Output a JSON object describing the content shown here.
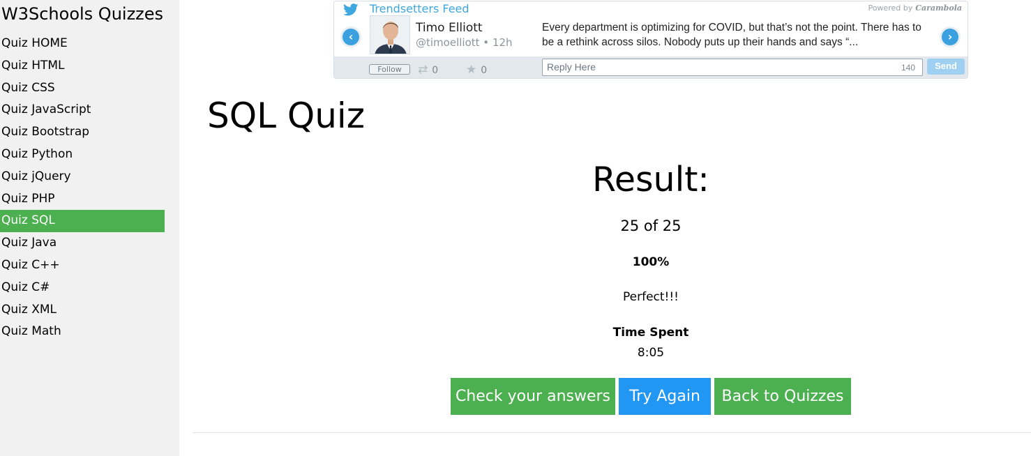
{
  "sidebar": {
    "title": "W3Schools Quizzes",
    "items": [
      {
        "label": "Quiz HOME"
      },
      {
        "label": "Quiz HTML"
      },
      {
        "label": "Quiz CSS"
      },
      {
        "label": "Quiz JavaScript"
      },
      {
        "label": "Quiz Bootstrap"
      },
      {
        "label": "Quiz Python"
      },
      {
        "label": "Quiz jQuery"
      },
      {
        "label": "Quiz PHP"
      },
      {
        "label": "Quiz SQL",
        "active": true
      },
      {
        "label": "Quiz Java"
      },
      {
        "label": "Quiz C++"
      },
      {
        "label": "Quiz C#"
      },
      {
        "label": "Quiz XML"
      },
      {
        "label": "Quiz Math"
      }
    ],
    "active_color": "#4caf50"
  },
  "twitter_widget": {
    "feed_title": "Trendsetters Feed",
    "powered_by": "Powered by",
    "powered_logo": "Carambola",
    "author_name": "Timo Elliott",
    "author_handle": "@timoelliott",
    "age": "• 12h",
    "tweet_text": "Every department is optimizing for COVID, but that’s not the point. There has to be a rethink across silos. Nobody puts up their hands and says “...",
    "follow_label": "Follow",
    "retweets": "0",
    "favorites": "0",
    "reply_placeholder": "Reply Here",
    "char_count": "140",
    "send_label": "Send",
    "icons": {
      "bird": "twitter-bird-icon",
      "prev": "chevron-left-icon",
      "next": "chevron-right-icon",
      "retweet": "retweet-icon",
      "favorite": "star-icon"
    },
    "accent_color": "#3ea7e0"
  },
  "main": {
    "page_title": "SQL Quiz",
    "result_heading": "Result:",
    "score": "25 of 25",
    "percent": "100%",
    "verdict": "Perfect!!!",
    "time_label": "Time Spent",
    "time_value": "8:05",
    "buttons": {
      "check": "Check your answers",
      "again": "Try Again",
      "back": "Back to Quizzes"
    },
    "colors": {
      "green": "#4caf50",
      "blue": "#2196f3"
    }
  }
}
